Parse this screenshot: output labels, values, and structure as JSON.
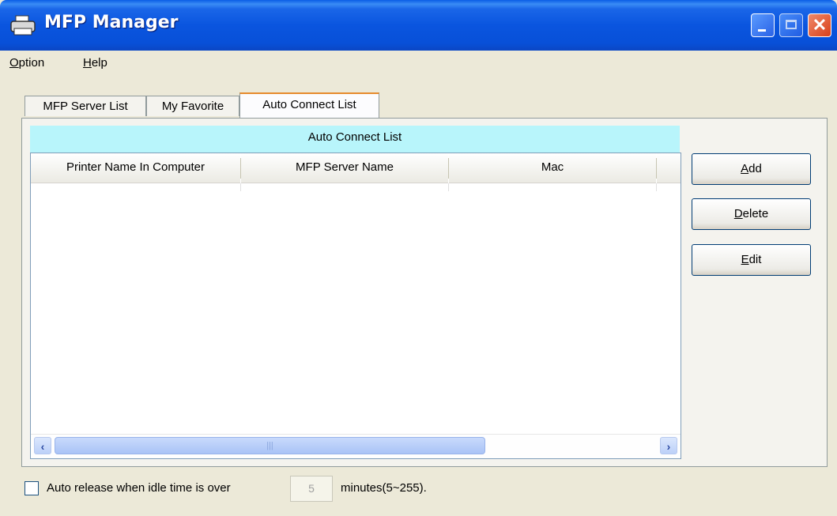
{
  "window": {
    "title": "MFP Manager"
  },
  "menu": [
    {
      "label_prefix": "O",
      "label_rest": "ption"
    },
    {
      "label_prefix": "H",
      "label_rest": "elp"
    }
  ],
  "tabs": [
    {
      "label": "MFP Server List",
      "active": false
    },
    {
      "label": "My Favorite",
      "active": false
    },
    {
      "label": "Auto Connect List",
      "active": true
    }
  ],
  "list": {
    "caption": "Auto Connect List",
    "columns": [
      "Printer Name In Computer",
      "MFP Server Name",
      "Mac",
      ""
    ],
    "rows": []
  },
  "buttons": {
    "add": {
      "prefix": "A",
      "rest": "dd"
    },
    "delete": {
      "prefix": "D",
      "rest": "elete"
    },
    "edit": {
      "prefix": "E",
      "rest": "dit"
    }
  },
  "auto_release": {
    "checked": false,
    "label_before": "Auto release when idle time is over",
    "minutes_value": "5",
    "label_after": "minutes(5~255)."
  },
  "colors": {
    "title_bar": "#0a55df",
    "list_caption_bg": "#b8f5fb",
    "window_bg": "#ece9d8",
    "active_tab_accent": "#e68b2c"
  },
  "icons": {
    "app": "printer-icon",
    "minimize": "minimize-icon",
    "maximize": "maximize-icon",
    "close": "close-icon"
  }
}
